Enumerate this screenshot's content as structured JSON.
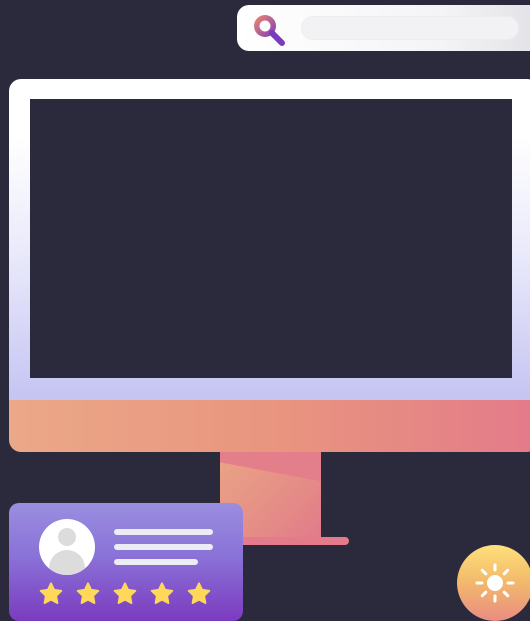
{
  "search": {
    "value": "",
    "placeholder": "",
    "icon": "search-icon",
    "icon_colors": [
      "#f08a6a",
      "#7b3bbf"
    ]
  },
  "monitor": {
    "bezel_color": "#ffffff",
    "screen_color": "#2a2a3c",
    "chin_gradient": [
      "#eba888",
      "#e37b8a"
    ]
  },
  "review_card": {
    "avatar_icon": "avatar-icon",
    "stars": 5,
    "rating": 5,
    "star_color": "#ffd85a",
    "background_gradient": [
      "#9a8ee0",
      "#7b3bbf"
    ]
  },
  "brightness_button": {
    "icon": "sun-icon",
    "background_gradient": [
      "#ffe07a",
      "#ea8c83"
    ]
  },
  "colors": {
    "background": "#2a2a3c",
    "accent": "#7b3bbf"
  }
}
